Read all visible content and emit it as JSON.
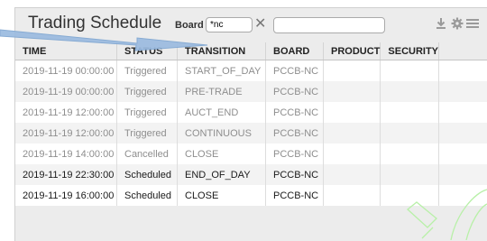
{
  "header": {
    "title": "Trading Schedule",
    "board_label": "Board",
    "board_value": "*nc",
    "search_value": ""
  },
  "icons": {
    "clear": "close-icon",
    "download": "download-icon",
    "settings": "gear-icon",
    "menu": "hamburger-menu-icon"
  },
  "columns": [
    "TIME",
    "STATUS",
    "TRANSITION",
    "BOARD",
    "PRODUCT",
    "SECURITY"
  ],
  "rows": [
    {
      "time": "2019-11-19 00:00:00",
      "status": "Triggered",
      "transition": "START_OF_DAY",
      "board": "PCCB-NC",
      "product": "",
      "security": ""
    },
    {
      "time": "2019-11-19 00:00:00",
      "status": "Triggered",
      "transition": "PRE-TRADE",
      "board": "PCCB-NC",
      "product": "",
      "security": ""
    },
    {
      "time": "2019-11-19 12:00:00",
      "status": "Triggered",
      "transition": "AUCT_END",
      "board": "PCCB-NC",
      "product": "",
      "security": ""
    },
    {
      "time": "2019-11-19 12:00:00",
      "status": "Triggered",
      "transition": "CONTINUOUS",
      "board": "PCCB-NC",
      "product": "",
      "security": ""
    },
    {
      "time": "2019-11-19 14:00:00",
      "status": "Cancelled",
      "transition": "CLOSE",
      "board": "PCCB-NC",
      "product": "",
      "security": ""
    },
    {
      "time": "2019-11-19 22:30:00",
      "status": "Scheduled",
      "transition": "END_OF_DAY",
      "board": "PCCB-NC",
      "product": "",
      "security": ""
    },
    {
      "time": "2019-11-19 16:00:00",
      "status": "Scheduled",
      "transition": "CLOSE",
      "board": "PCCB-NC",
      "product": "",
      "security": ""
    }
  ],
  "colors": {
    "panel_bg": "#ececec",
    "pointer": "#7fa6d1",
    "watermark": "#b8f0a8"
  }
}
